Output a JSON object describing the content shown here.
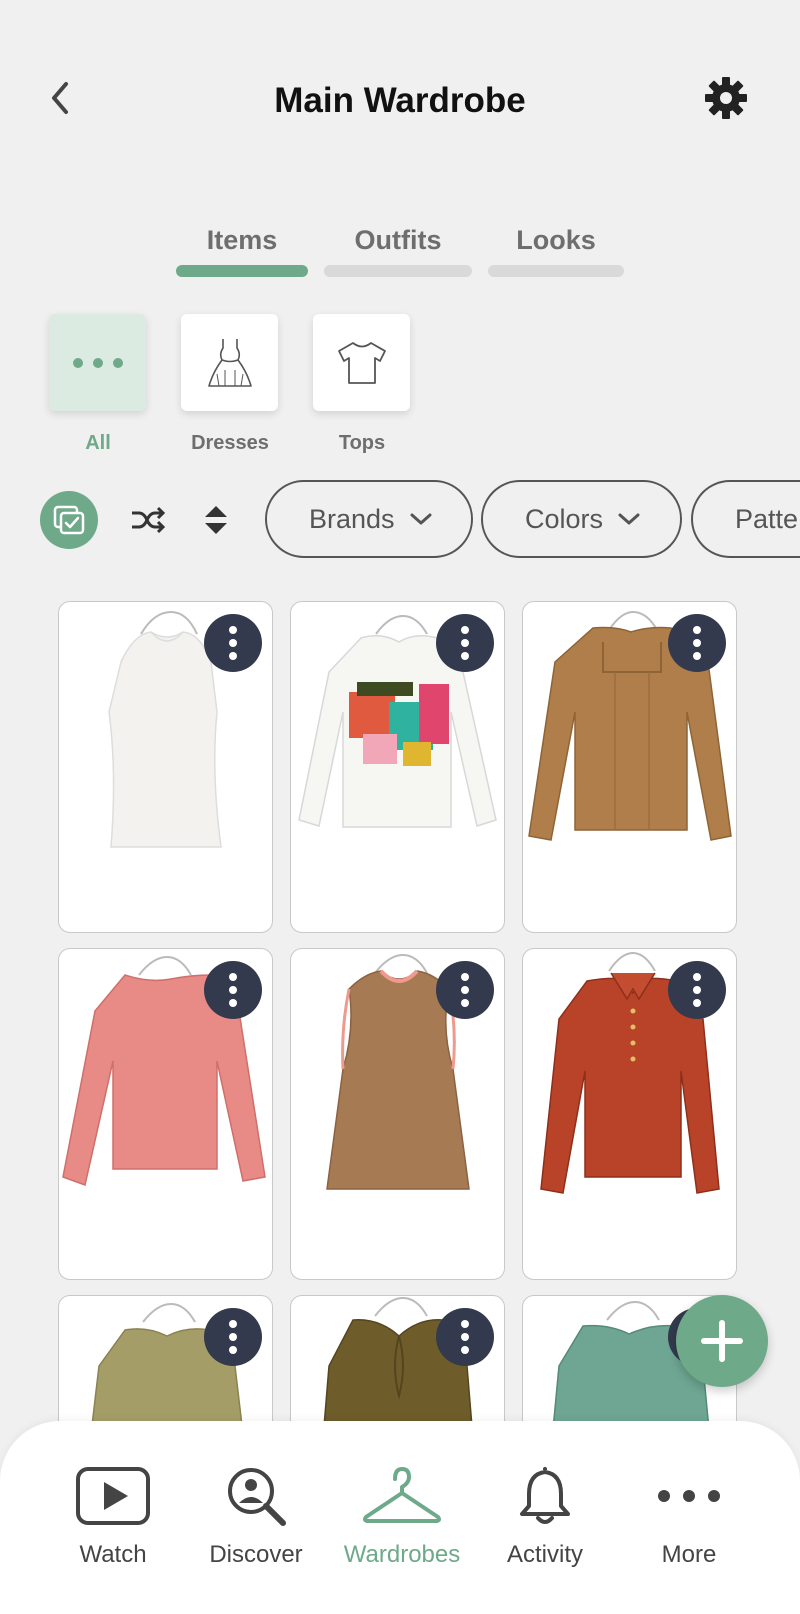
{
  "header": {
    "title": "Main Wardrobe",
    "back_icon": "chevron-left-icon",
    "settings_icon": "gear-icon"
  },
  "tabs": [
    {
      "label": "Items",
      "active": true
    },
    {
      "label": "Outfits",
      "active": false
    },
    {
      "label": "Looks",
      "active": false
    }
  ],
  "categories": [
    {
      "label": "All",
      "icon": "more-dots-icon",
      "selected": true
    },
    {
      "label": "Dresses",
      "icon": "dress-icon",
      "selected": false
    },
    {
      "label": "Tops",
      "icon": "tshirt-icon",
      "selected": false
    }
  ],
  "filters": {
    "select_icon": "multi-select-icon",
    "shuffle_icon": "shuffle-icon",
    "sort_icon": "sort-icon",
    "pills": [
      {
        "label": "Brands"
      },
      {
        "label": "Colors"
      },
      {
        "label": "Patte"
      }
    ]
  },
  "items": [
    {
      "garment": "white sleeveless top",
      "color": "#f4f2ee"
    },
    {
      "garment": "white long sleeve graphic top",
      "color": "#f6f6f3"
    },
    {
      "garment": "tan knit long sleeve top",
      "color": "#b07e4a"
    },
    {
      "garment": "pink long sleeve top",
      "color": "#e88a85"
    },
    {
      "garment": "brown sleeveless top",
      "color": "#a67a52"
    },
    {
      "garment": "rust collared blouse",
      "color": "#b94329"
    },
    {
      "garment": "olive long sleeve top",
      "color": "#a59d68"
    },
    {
      "garment": "olive ruched top",
      "color": "#6e5d2a"
    },
    {
      "garment": "sage green long sleeve top",
      "color": "#6ea693"
    }
  ],
  "fab_icon": "plus-icon",
  "bottom_nav": [
    {
      "label": "Watch",
      "icon": "play-icon",
      "active": false
    },
    {
      "label": "Discover",
      "icon": "discover-icon",
      "active": false
    },
    {
      "label": "Wardrobes",
      "icon": "hanger-icon",
      "active": true
    },
    {
      "label": "Activity",
      "icon": "bell-icon",
      "active": false
    },
    {
      "label": "More",
      "icon": "more-dots-icon",
      "active": false
    }
  ],
  "colors": {
    "accent": "#6ea98a",
    "accent_light": "#dcebe1",
    "kebab": "#333a4e",
    "background": "#f0f0f0"
  }
}
